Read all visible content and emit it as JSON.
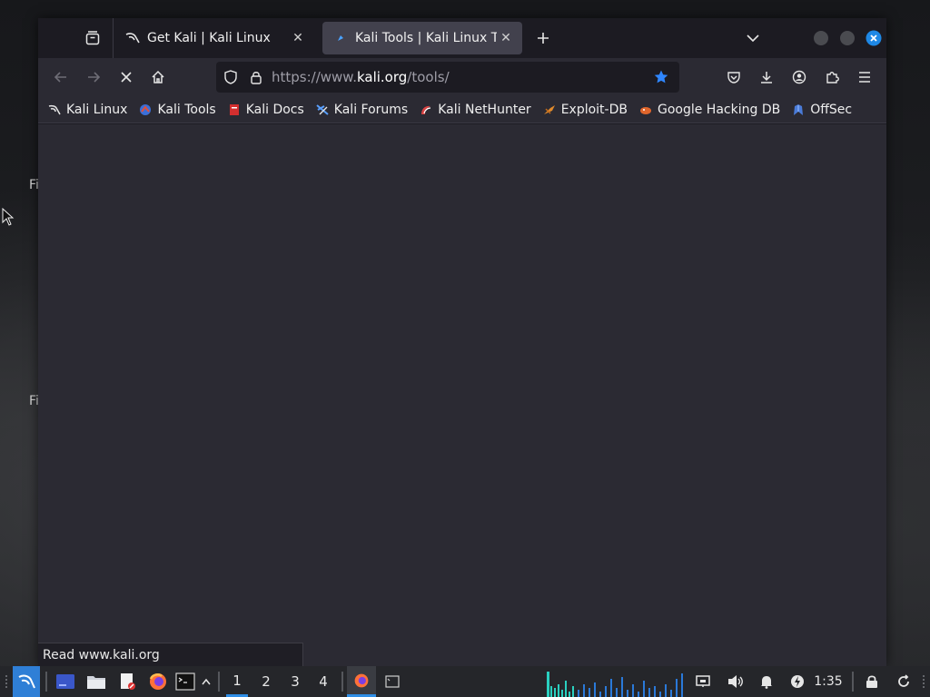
{
  "desktop": {
    "icon_labels": [
      "Fi",
      "Fi"
    ]
  },
  "browser": {
    "tabs": [
      {
        "title": "Get Kali | Kali Linux",
        "active": false
      },
      {
        "title": "Kali Tools | Kali Linux Tool",
        "active": true
      }
    ],
    "url_prefix": "https://www.",
    "url_domain": "kali.org",
    "url_path": "/tools/",
    "bookmarks": [
      {
        "label": "Kali Linux",
        "icon": "kali-dragon-icon"
      },
      {
        "label": "Kali Tools",
        "icon": "kali-tools-icon"
      },
      {
        "label": "Kali Docs",
        "icon": "kali-docs-icon"
      },
      {
        "label": "Kali Forums",
        "icon": "kali-forums-icon"
      },
      {
        "label": "Kali NetHunter",
        "icon": "nethunter-icon"
      },
      {
        "label": "Exploit-DB",
        "icon": "exploit-db-icon"
      },
      {
        "label": "Google Hacking DB",
        "icon": "ghdb-icon"
      },
      {
        "label": "OffSec",
        "icon": "offsec-icon"
      }
    ],
    "status_text": "Read www.kali.org",
    "bookmark_starred": true,
    "loading": true
  },
  "taskbar": {
    "workspaces": [
      "1",
      "2",
      "3",
      "4"
    ],
    "active_workspace": "1",
    "clock": "1:35"
  },
  "colors": {
    "accent": "#2f8ee6",
    "star": "#2f86ff",
    "close_button": "#1e88e5"
  }
}
